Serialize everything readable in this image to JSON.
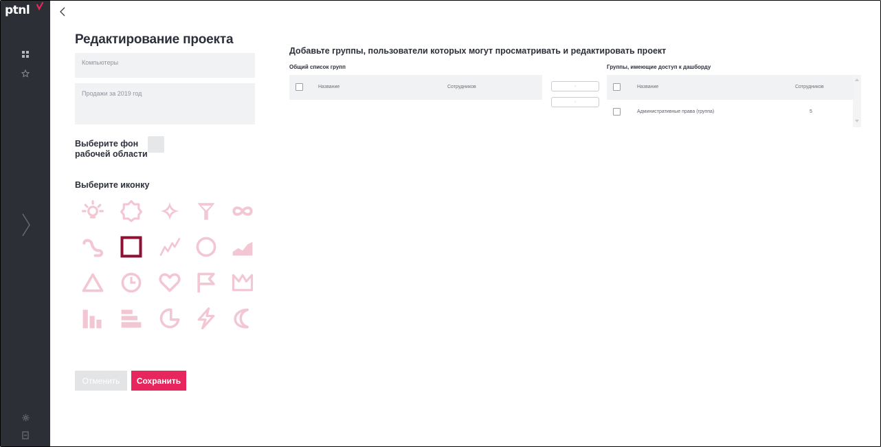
{
  "sidebar": {
    "logo_text": "ptnl",
    "icons": [
      "dashboard-icon",
      "star-icon",
      "gear-icon",
      "logout-icon"
    ]
  },
  "form": {
    "title": "Редактирование проекта",
    "name_value": "Компьютеры",
    "description_value": "Продажи за 2019 год",
    "background_label": "Выберите фон рабочей области",
    "icon_label": "Выберите иконку",
    "icons": [
      "lightbulb-icon",
      "gear-outline-icon",
      "sparkle-icon",
      "funnel-icon",
      "infinity-icon",
      "route-icon",
      "square-icon",
      "trend-line-icon",
      "circle-icon",
      "area-chart-icon",
      "triangle-icon",
      "clock-icon",
      "heart-icon",
      "flag-icon",
      "crown-icon",
      "bar-chart-icon",
      "horizontal-bars-icon",
      "pie-chart-icon",
      "lightning-icon",
      "moon-icon"
    ],
    "selected_icon": "square-icon",
    "cancel_label": "Отменить",
    "save_label": "Сохранить"
  },
  "access": {
    "title": "Добавьте группы, пользователи которых могут просматривать и редактировать проект",
    "all_groups": {
      "title": "Общий список групп",
      "col_name": "Название",
      "col_employees": "Сотрудников",
      "rows": []
    },
    "granted_groups": {
      "title": "Группы, имеющие доступ к дашборду",
      "col_name": "Название",
      "col_employees": "Сотрудников",
      "rows": [
        {
          "name": "Административные права (группа)",
          "employees": "5"
        }
      ]
    },
    "move_right": "›",
    "move_left": "‹"
  },
  "colors": {
    "sidebar_bg": "#2d2f36",
    "accent": "#e8265e",
    "icon_inactive": "#f3c6d3",
    "icon_selected": "#8e1133"
  }
}
